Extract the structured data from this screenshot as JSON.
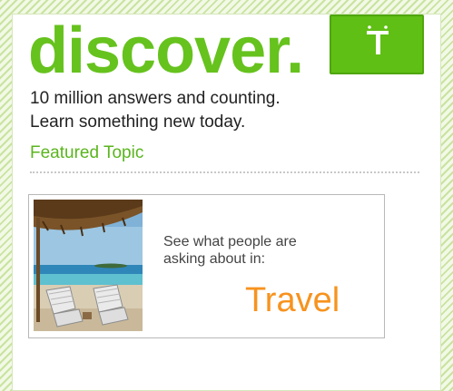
{
  "widget": {
    "title": "discover.",
    "logo_icon": "t-logo-icon",
    "tagline_line1": "10 million answers and counting.",
    "tagline_line2": "Learn something new today.",
    "featured_link": "Featured Topic",
    "colors": {
      "brand_green": "#66c21d",
      "logo_green": "#5fbf14",
      "link_green": "#5ab51d",
      "topic_orange": "#f7931e",
      "text_dark": "#222222"
    }
  },
  "featured": {
    "image": "beach-chairs-image",
    "caption_line1": "See what people are",
    "caption_line2": "asking about in:",
    "topic": "Travel"
  }
}
